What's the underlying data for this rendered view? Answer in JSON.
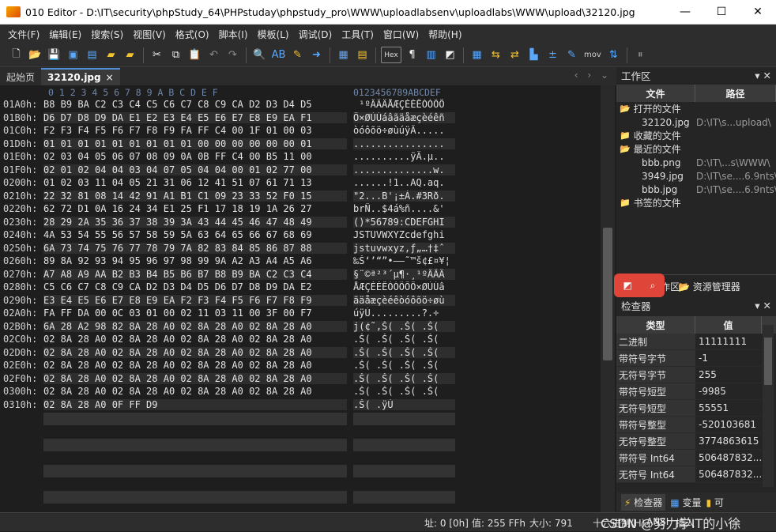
{
  "window": {
    "title": "010 Editor - D:\\IT\\security\\phpStudy_64\\PHPstuday\\phpstudy_pro\\WWW\\uploadlabsenv\\uploadlabs\\WWW\\upload\\32120.jpg",
    "min": "—",
    "max": "☐",
    "close": "✕"
  },
  "menu": [
    "文件(F)",
    "编辑(E)",
    "搜索(S)",
    "视图(V)",
    "格式(O)",
    "脚本(I)",
    "模板(L)",
    "调试(D)",
    "工具(T)",
    "窗口(W)",
    "帮助(H)"
  ],
  "tabs": {
    "start": "起始页",
    "active": "32120.jpg",
    "close": "×",
    "nav": "‹ › ⌄"
  },
  "hex": {
    "col_header": "0  1  2  3  4  5  6  7  8  9  A  B  C  D  E  F",
    "ascii_header": "0123456789ABCDEF",
    "rows": [
      {
        "addr": "01A0h:",
        "bytes": "B8 B9 BA C2 C3 C4 C5 C6 C7 C8 C9 CA D2 D3 D4 D5",
        "ascii": " ¹ºÂÃÄÅÆÇÈÉÊÒÓÔÕ"
      },
      {
        "addr": "01B0h:",
        "bytes": "D6 D7 D8 D9 DA E1 E2 E3 E4 E5 E6 E7 E8 E9 EA F1",
        "ascii": "Ö×ØÙÚáâãäåæçèéêñ"
      },
      {
        "addr": "01C0h:",
        "bytes": "F2 F3 F4 F5 F6 F7 F8 F9 FA FF C4 00 1F 01 00 03",
        "ascii": "òóôõö÷øùúÿÄ....."
      },
      {
        "addr": "01D0h:",
        "bytes": "01 01 01 01 01 01 01 01 01 00 00 00 00 00 00 01",
        "ascii": "................"
      },
      {
        "addr": "01E0h:",
        "bytes": "02 03 04 05 06 07 08 09 0A 0B FF C4 00 B5 11 00",
        "ascii": "..........ÿÄ.µ.."
      },
      {
        "addr": "01F0h:",
        "bytes": "02 01 02 04 04 03 04 07 05 04 04 00 01 02 77 00",
        "ascii": "..............w."
      },
      {
        "addr": "0200h:",
        "bytes": "01 02 03 11 04 05 21 31 06 12 41 51 07 61 71 13",
        "ascii": "......!1..AQ.aq."
      },
      {
        "addr": "0210h:",
        "bytes": "22 32 81 08 14 42 91 A1 B1 C1 09 23 33 52 F0 15",
        "ascii": "\"2...B'¡±Á.#3Rð."
      },
      {
        "addr": "0220h:",
        "bytes": "62 72 D1 0A 16 24 34 E1 25 F1 17 18 19 1A 26 27",
        "ascii": "brÑ..$4á%ñ....&'"
      },
      {
        "addr": "0230h:",
        "bytes": "28 29 2A 35 36 37 38 39 3A 43 44 45 46 47 48 49",
        "ascii": "()*56789:CDEFGHI"
      },
      {
        "addr": "0240h:",
        "bytes": "4A 53 54 55 56 57 58 59 5A 63 64 65 66 67 68 69",
        "ascii": "JSTUVWXYZcdefghi"
      },
      {
        "addr": "0250h:",
        "bytes": "6A 73 74 75 76 77 78 79 7A 82 83 84 85 86 87 88",
        "ascii": "jstuvwxyz‚ƒ„…†‡ˆ"
      },
      {
        "addr": "0260h:",
        "bytes": "89 8A 92 93 94 95 96 97 98 99 9A A2 A3 A4 A5 A6",
        "ascii": "‰Š‘’“”•–—˜™š¢£¤¥¦"
      },
      {
        "addr": "0270h:",
        "bytes": "A7 A8 A9 AA B2 B3 B4 B5 B6 B7 B8 B9 BA C2 C3 C4",
        "ascii": "§¨©ª²³´µ¶·¸¹ºÂÃÄ"
      },
      {
        "addr": "0280h:",
        "bytes": "C5 C6 C7 C8 C9 CA D2 D3 D4 D5 D6 D7 D8 D9 DA E2",
        "ascii": "ÅÆÇÈÉÊÒÓÔÕÖ×ØÙÚâ"
      },
      {
        "addr": "0290h:",
        "bytes": "E3 E4 E5 E6 E7 E8 E9 EA F2 F3 F4 F5 F6 F7 F8 F9",
        "ascii": "ãäåæçèéêòóôõö÷øù"
      },
      {
        "addr": "02A0h:",
        "bytes": "FA FF DA 00 0C 03 01 00 02 11 03 11 00 3F 00 F7",
        "ascii": "úÿÚ.........?.÷"
      },
      {
        "addr": "02B0h:",
        "bytes": "6A 28 A2 98 82 8A 28 A0 02 8A 28 A0 02 8A 28 A0",
        "ascii": "j(¢˜‚Š( .Š( .Š( "
      },
      {
        "addr": "02C0h:",
        "bytes": "02 8A 28 A0 02 8A 28 A0 02 8A 28 A0 02 8A 28 A0",
        "ascii": ".Š( .Š( .Š( .Š( "
      },
      {
        "addr": "02D0h:",
        "bytes": "02 8A 28 A0 02 8A 28 A0 02 8A 28 A0 02 8A 28 A0",
        "ascii": ".Š( .Š( .Š( .Š( "
      },
      {
        "addr": "02E0h:",
        "bytes": "02 8A 28 A0 02 8A 28 A0 02 8A 28 A0 02 8A 28 A0",
        "ascii": ".Š( .Š( .Š( .Š( "
      },
      {
        "addr": "02F0h:",
        "bytes": "02 8A 28 A0 02 8A 28 A0 02 8A 28 A0 02 8A 28 A0",
        "ascii": ".Š( .Š( .Š( .Š( "
      },
      {
        "addr": "0300h:",
        "bytes": "02 8A 28 A0 02 8A 28 A0 02 8A 28 A0 02 8A 28 A0",
        "ascii": ".Š( .Š( .Š( .Š( "
      },
      {
        "addr": "0310h:",
        "bytes": "02 8A 28 A0 0F FF D9",
        "ascii": ".Š( .ÿÙ"
      }
    ]
  },
  "workspace": {
    "title": "工作区",
    "col_file": "文件",
    "col_path": "路径",
    "open_folder": "打开的文件",
    "open_files": [
      {
        "name": "32120.jpg",
        "path": "D:\\IT\\s...upload\\"
      }
    ],
    "fav_folder": "收藏的文件",
    "recent_folder": "最近的文件",
    "recent_files": [
      {
        "name": "bbb.png",
        "path": "D:\\IT\\...s\\WWW\\"
      },
      {
        "name": "3949.jpg",
        "path": "D:\\IT\\se....6.9nts\\"
      },
      {
        "name": "bbb.jpg",
        "path": "D:\\IT\\se....6.9nts\\"
      }
    ],
    "bookmark_folder": "书签的文件",
    "tab_work": "工作区",
    "tab_explorer": "资源管理器"
  },
  "inspector": {
    "title": "检查器",
    "col_type": "类型",
    "col_value": "值",
    "rows": [
      {
        "type": "二进制",
        "value": "11111111"
      },
      {
        "type": "带符号字节",
        "value": "-1"
      },
      {
        "type": "无符号字节",
        "value": "255"
      },
      {
        "type": "带符号短型",
        "value": "-9985"
      },
      {
        "type": "无符号短型",
        "value": "55551"
      },
      {
        "type": "带符号整型",
        "value": "-520103681"
      },
      {
        "type": "无符号整型",
        "value": "3774863615"
      },
      {
        "type": "带符号 Int64",
        "value": "506487832..."
      },
      {
        "type": "无符号 Int64",
        "value": "506487832..."
      }
    ],
    "tab_inspector": "检查器",
    "tab_vars": "变量",
    "tab_more": "可"
  },
  "status": {
    "addr": "址: 0 [0h]",
    "value": "值: 255 FFh",
    "size": "大小: 791",
    "hexmode": "十六进制(H)",
    "ansi": "ANSI",
    "ins": "插入",
    "watermark": "CSDN @努力学IT的小徐"
  }
}
